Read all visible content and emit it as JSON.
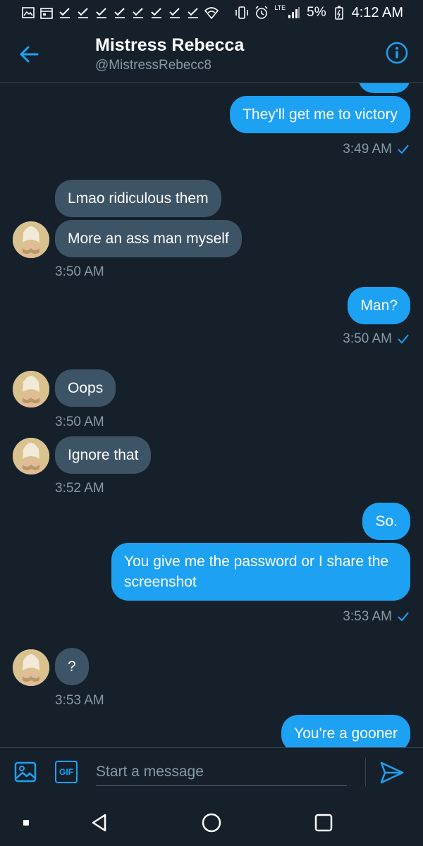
{
  "status_bar": {
    "battery": "5%",
    "time": "4:12 AM",
    "network": "LTE",
    "icons_left": [
      "gallery-icon",
      "calendar-icon",
      "check-icon",
      "check-icon",
      "check-icon",
      "check-icon",
      "check-icon",
      "check-icon",
      "check-icon",
      "check-icon",
      "wifi-icon"
    ],
    "icons_right": [
      "vibrate-icon",
      "alarm-icon",
      "signal-icon",
      "battery-icon"
    ]
  },
  "header": {
    "name": "Mistress Rebecca",
    "handle": "@MistressRebecc8"
  },
  "messages": [
    {
      "dir": "out",
      "text": "They'll get me to victory"
    },
    {
      "time": "3:49 AM",
      "dir": "out",
      "read": true
    },
    {
      "dir": "in",
      "text": "Lmao ridiculous them"
    },
    {
      "dir": "in",
      "text": "More an ass man myself"
    },
    {
      "time": "3:50 AM",
      "dir": "in"
    },
    {
      "dir": "out",
      "text": "Man?"
    },
    {
      "time": "3:50 AM",
      "dir": "out",
      "read": true
    },
    {
      "dir": "in",
      "text": "Oops"
    },
    {
      "time": "3:50 AM",
      "dir": "in"
    },
    {
      "dir": "in",
      "text": "Ignore that"
    },
    {
      "time": "3:52 AM",
      "dir": "in"
    },
    {
      "dir": "out",
      "text": "So."
    },
    {
      "dir": "out",
      "text": "You give me the password or I share the screenshot"
    },
    {
      "time": "3:53 AM",
      "dir": "out",
      "read": true
    },
    {
      "dir": "in",
      "text": "?"
    },
    {
      "time": "3:53 AM",
      "dir": "in"
    },
    {
      "dir": "out",
      "text": "You're a gooner"
    }
  ],
  "composer": {
    "placeholder": "Start a message",
    "gif_label": "GIF"
  },
  "colors": {
    "background": "#15202b",
    "accent": "#1da1f2",
    "incoming_bubble": "#3d5466",
    "muted_text": "#8899a6"
  }
}
